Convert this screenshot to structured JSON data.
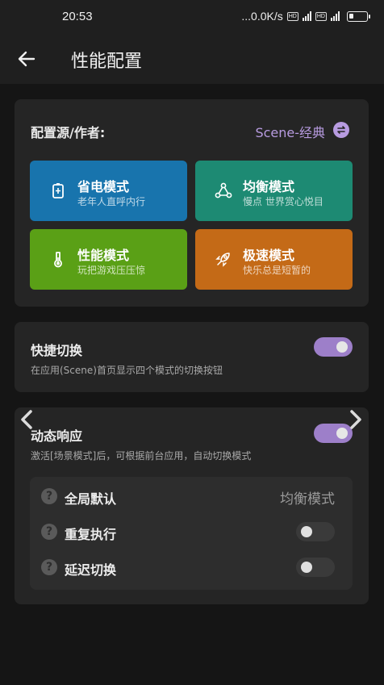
{
  "status_bar": {
    "time": "20:53",
    "network_speed": "...0.0K/s",
    "hd_badge": "HD",
    "lte_badge": "4G"
  },
  "app_bar": {
    "back_icon": "arrow-left-icon",
    "title": "性能配置"
  },
  "config_source": {
    "label": "配置源/作者:",
    "value": "Scene-经典",
    "accent_color": "#b79be0"
  },
  "modes": [
    {
      "name": "省电模式",
      "subtitle": "老年人直呼内行",
      "icon": "battery-icon",
      "color": "#1874ad"
    },
    {
      "name": "均衡模式",
      "subtitle": "慢点 世界赏心悦目",
      "icon": "triangle-nodes-icon",
      "color": "#1d8a73"
    },
    {
      "name": "性能模式",
      "subtitle": "玩把游戏压压惊",
      "icon": "thermometer-icon",
      "color": "#5aa016"
    },
    {
      "name": "极速模式",
      "subtitle": "快乐总是短暂的",
      "icon": "rocket-icon",
      "color": "#c46a17"
    }
  ],
  "quick_switch": {
    "title": "快捷切换",
    "description": "在应用(Scene)首页显示四个模式的切换按钮",
    "enabled": true
  },
  "dynamic_response": {
    "title": "动态响应",
    "description": "激活[场景模式]后，可根据前台应用，自动切换模式",
    "enabled": true,
    "options": [
      {
        "label": "全局默认",
        "value": "均衡模式"
      },
      {
        "label": "重复执行",
        "enabled": false
      },
      {
        "label": "延迟切换",
        "enabled": false
      }
    ]
  }
}
